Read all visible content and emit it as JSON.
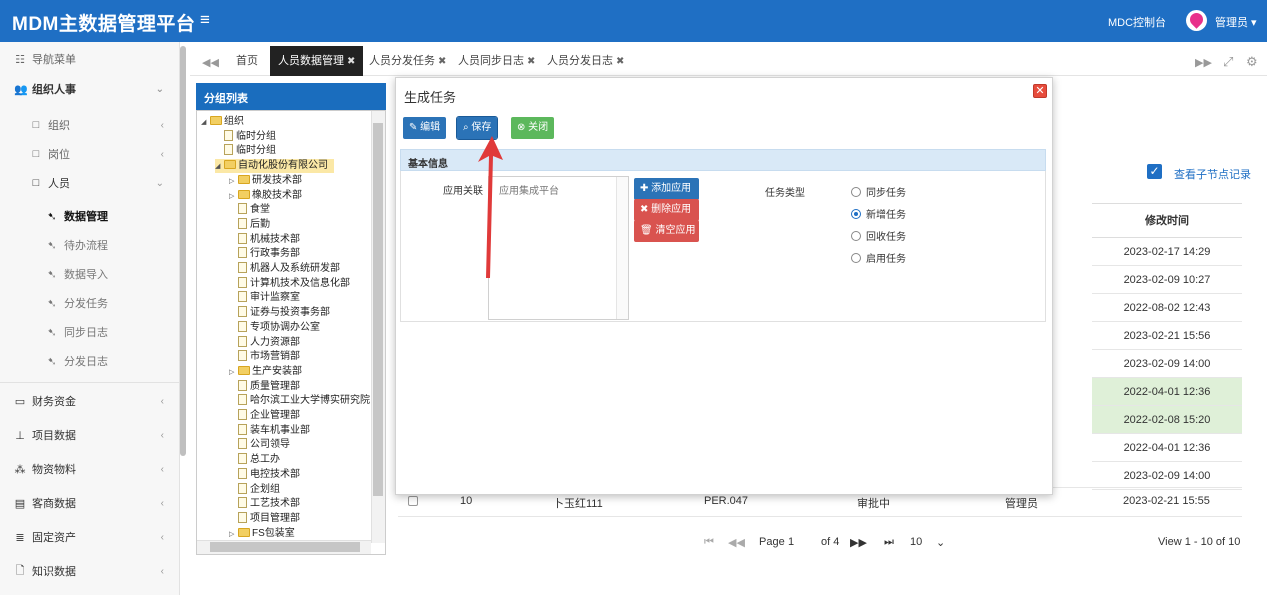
{
  "header": {
    "brand": "MDM主数据管理平台",
    "menu_toggle": "≡",
    "mdc": "MDC控制台",
    "user": "管理员 ▾"
  },
  "sidebar": {
    "nav_title": "导航菜单",
    "groups": [
      {
        "label": "组织人事",
        "expanded": true
      },
      {
        "label": "财务资金"
      },
      {
        "label": "项目数据"
      },
      {
        "label": "物资物料"
      },
      {
        "label": "客商数据"
      },
      {
        "label": "固定资产"
      },
      {
        "label": "知识数据"
      }
    ],
    "sub": [
      "组织",
      "岗位",
      "人员"
    ],
    "person_items": [
      "数据管理",
      "待办流程",
      "数据导入",
      "分发任务",
      "同步日志",
      "分发日志"
    ]
  },
  "tabs": [
    {
      "label": "首页",
      "close": ""
    },
    {
      "label": "人员数据管理",
      "close": "✖",
      "active": true
    },
    {
      "label": "人员分发任务",
      "close": "✖"
    },
    {
      "label": "人员同步日志",
      "close": "✖"
    },
    {
      "label": "人员分发日志",
      "close": "✖"
    }
  ],
  "tree": {
    "title": "分组列表",
    "nodes": [
      {
        "label": "组织",
        "kind": "folder-open",
        "level": 0
      },
      {
        "label": "临时分组",
        "kind": "doc",
        "level": 1
      },
      {
        "label": "临时分组",
        "kind": "doc",
        "level": 1
      },
      {
        "label": "自动化股份有限公司",
        "kind": "folder-open",
        "level": 1,
        "selected": true
      },
      {
        "label": "研发技术部",
        "kind": "folder",
        "level": 2
      },
      {
        "label": "橡胶技术部",
        "kind": "folder",
        "level": 2
      },
      {
        "label": "食堂",
        "kind": "doc",
        "level": 2
      },
      {
        "label": "后勤",
        "kind": "doc",
        "level": 2
      },
      {
        "label": "机械技术部",
        "kind": "doc",
        "level": 2
      },
      {
        "label": "行政事务部",
        "kind": "doc",
        "level": 2
      },
      {
        "label": "机器人及系统研发部",
        "kind": "doc",
        "level": 2
      },
      {
        "label": "计算机技术及信息化部",
        "kind": "doc",
        "level": 2
      },
      {
        "label": "审计监察室",
        "kind": "doc",
        "level": 2
      },
      {
        "label": "证券与投资事务部",
        "kind": "doc",
        "level": 2
      },
      {
        "label": "专项协调办公室",
        "kind": "doc",
        "level": 2
      },
      {
        "label": "人力资源部",
        "kind": "doc",
        "level": 2
      },
      {
        "label": "市场营销部",
        "kind": "doc",
        "level": 2
      },
      {
        "label": "生产安装部",
        "kind": "folder",
        "level": 2
      },
      {
        "label": "质量管理部",
        "kind": "doc",
        "level": 2
      },
      {
        "label": "哈尔滨工业大学博实研究院",
        "kind": "doc",
        "level": 2
      },
      {
        "label": "企业管理部",
        "kind": "doc",
        "level": 2
      },
      {
        "label": "装车机事业部",
        "kind": "doc",
        "level": 2
      },
      {
        "label": "公司领导",
        "kind": "doc",
        "level": 2
      },
      {
        "label": "总工办",
        "kind": "doc",
        "level": 2
      },
      {
        "label": "电控技术部",
        "kind": "doc",
        "level": 2
      },
      {
        "label": "企划组",
        "kind": "doc",
        "level": 2
      },
      {
        "label": "工艺技术部",
        "kind": "doc",
        "level": 2
      },
      {
        "label": "项目管理部",
        "kind": "doc",
        "level": 2
      },
      {
        "label": "FS包装室",
        "kind": "folder",
        "level": 2
      }
    ]
  },
  "grid": {
    "show_child_label": "查看子节点记录",
    "modify_time_header": "修改时间",
    "modify_times": [
      "2023-02-17 14:29",
      "2023-02-09 10:27",
      "2022-08-02 12:43",
      "2023-02-21 15:56",
      "2023-02-09 14:00",
      "2022-04-01 12:36",
      "2022-02-08 15:20",
      "2022-04-01 12:36",
      "2023-02-09 14:00",
      "2023-02-21 15:55"
    ],
    "highlight_rows": [
      5,
      6
    ],
    "row10": {
      "num": "10",
      "name": "卜玉红111",
      "code": "PER.047",
      "status": "审批中",
      "user": "管理员"
    },
    "pager": {
      "page_label": "Page",
      "page": "1",
      "of": "of 4",
      "size": "10",
      "view": "View 1 - 10 of 10"
    }
  },
  "modal": {
    "title": "生成任务",
    "buttons": {
      "edit": "编辑",
      "save": "保存",
      "close": "关闭"
    },
    "section": "基本信息",
    "app_label": "应用关联",
    "app_list": [
      "应用集成平台"
    ],
    "app_buttons": {
      "add": "添加应用",
      "remove": "删除应用",
      "clear": "清空应用"
    },
    "type_label": "任务类型",
    "types": [
      "同步任务",
      "新增任务",
      "回收任务",
      "启用任务"
    ],
    "selected_type": "新增任务"
  },
  "colors": {
    "primary": "#1f6fc4",
    "save_btn": "#2b73b7",
    "close_btn": "#5cb85c",
    "danger": "#d9534f",
    "highlight_row": "#dff0d8",
    "arrow": "#e03a3a"
  }
}
